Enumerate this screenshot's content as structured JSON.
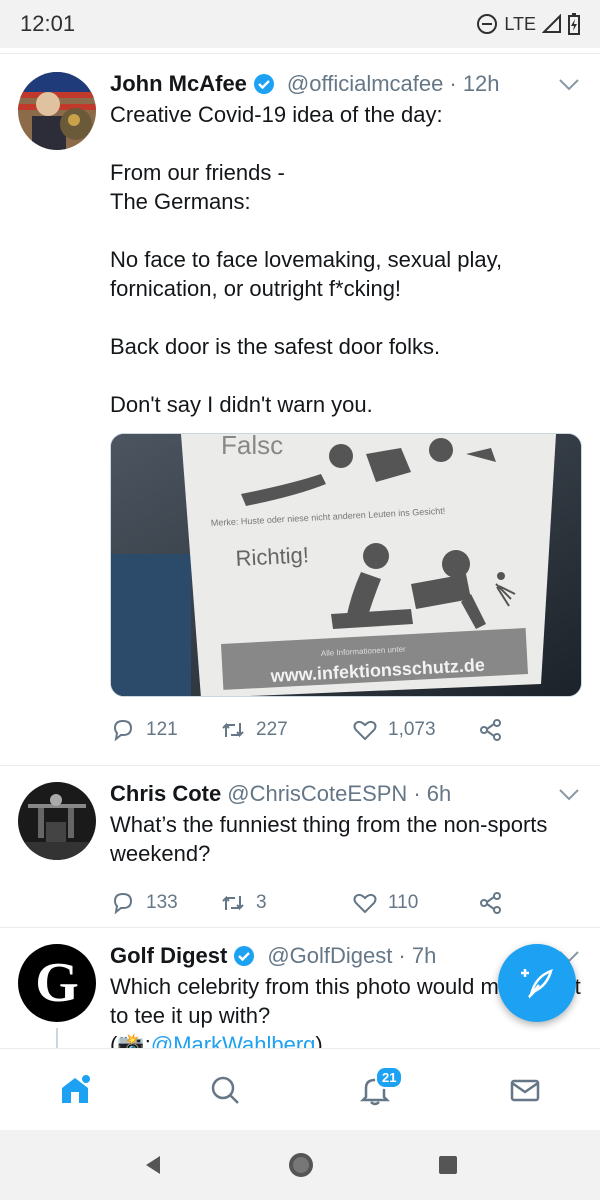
{
  "status_bar": {
    "time": "12:01",
    "network": "LTE"
  },
  "tweets": [
    {
      "name": "John McAfee",
      "verified": true,
      "handle": "@officialmcafee",
      "time": "· 12h",
      "text": "Creative Covid-19 idea of the day:\n\nFrom our friends -\nThe Germans:\n\nNo face to face lovemaking, sexual play, fornication, or outright f*cking!\n\nBack door is the safest door folks.\n\nDon't say I didn't warn you.",
      "media": {
        "top_word": "Falsc",
        "merke": "Merke: Huste oder niese nicht anderen Leuten ins Gesicht!",
        "richtig": "Richtig!",
        "info": "Alle Informationen unter",
        "url": "www.infektionsschutz.de"
      },
      "stats": {
        "replies": "121",
        "retweets": "227",
        "likes": "1,073"
      }
    },
    {
      "name": "Chris Cote",
      "verified": false,
      "handle": "@ChrisCoteESPN",
      "time": "· 6h",
      "text": "What’s the funniest thing from the non-sports weekend?",
      "stats": {
        "replies": "133",
        "retweets": "3",
        "likes": "110"
      }
    },
    {
      "name": "Golf Digest",
      "verified": true,
      "handle": "@GolfDigest",
      "time": "· 7h",
      "text_start": "Which celebrity from this photo would most want to tee it up with?\n(",
      "text_emoji": "📸",
      "text_colon": ":",
      "text_link": "@MarkWahlberg",
      "text_end": ")",
      "avatar_letter": "G"
    }
  ],
  "bottom_nav": {
    "notifications_badge": "21"
  },
  "colors": {
    "accent": "#1da1f2",
    "text": "#14171a",
    "muted": "#657786"
  }
}
